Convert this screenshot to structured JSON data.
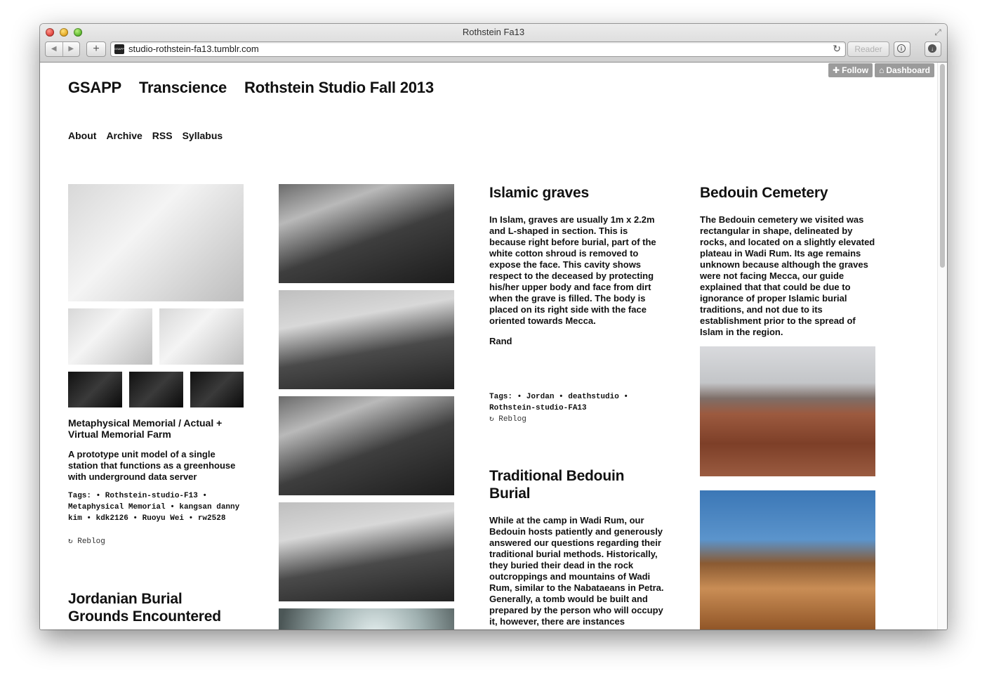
{
  "browser": {
    "window_title": "Rothstein Fa13",
    "url": "studio-rothstein-fa13.tumblr.com",
    "favicon_text": "GSAPP",
    "reader_label": "Reader"
  },
  "tumblr_controls": {
    "follow_label": "Follow",
    "dashboard_label": "Dashboard"
  },
  "header": {
    "school": "GSAPP",
    "theme": "Transcience",
    "studio": "Rothstein Studio Fall 2013"
  },
  "nav": [
    "About",
    "Archive",
    "RSS",
    "Syllabus"
  ],
  "posts": {
    "memorial": {
      "title": "Metaphysical Memorial / Actual + Virtual Memorial Farm",
      "body": "A prototype unit model of a single station that functions as a greenhouse with underground data server",
      "tags": "Tags: • Rothstein-studio-F13 • Metaphysical Memorial • kangsan danny kim • kdk2126 • Ruoyu Wei • rw2528",
      "reblog": "Reblog"
    },
    "jordanian": {
      "title": "Jordanian Burial Grounds Encountered"
    },
    "islamic": {
      "title": "Islamic graves",
      "body": "In Islam, graves are usually 1m x 2.2m and L-shaped in section. This is because right before burial, part of the white cotton shroud is removed to expose the face. This cavity shows respect to the deceased by protecting his/her upper body and face from dirt when the grave is filled. The body is placed on its right side with the face oriented towards Mecca.",
      "author": "Rand",
      "tags": "Tags: • Jordan • deathstudio • Rothstein-studio-FA13",
      "reblog": "Reblog"
    },
    "bedouin_burial": {
      "title": "Traditional Bedouin Burial",
      "body": "While at the camp in Wadi Rum, our Bedouin hosts patiently and generously answered our questions regarding their traditional burial methods. Historically, they buried their dead in the rock outcroppings and mountains of Wadi Rum, similar to the Nabataeans in Petra. Generally, a tomb would be built and prepared by the person who will occupy it, however, there are instances"
    },
    "bedouin_cemetery": {
      "title": "Bedouin Cemetery",
      "body": "The Bedouin cemetery we visited was rectangular in shape, delineated by rocks, and located on a slightly elevated plateau in Wadi Rum. Its age remains unknown because although the graves were not facing Mecca, our guide explained that that could be due to ignorance of proper Islamic burial traditions, and not due to its establishment prior to the spread of Islam in the region."
    }
  }
}
